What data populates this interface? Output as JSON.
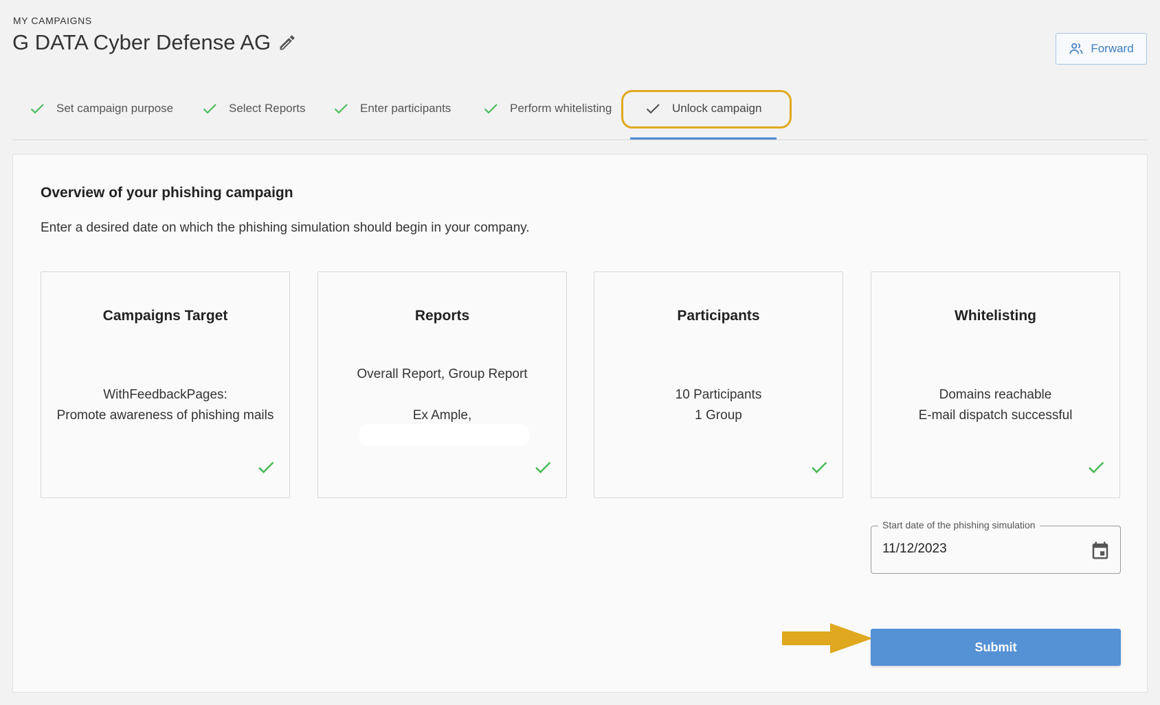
{
  "header": {
    "breadcrumb": "MY CAMPAIGNS",
    "title": "G DATA Cyber Defense AG",
    "forward_label": "Forward"
  },
  "steps": [
    {
      "label": "Set campaign purpose",
      "state": "done"
    },
    {
      "label": "Select Reports",
      "state": "done"
    },
    {
      "label": "Enter participants",
      "state": "done"
    },
    {
      "label": "Perform whitelisting",
      "state": "done"
    },
    {
      "label": "Unlock campaign",
      "state": "active"
    }
  ],
  "overview": {
    "title": "Overview of your phishing campaign",
    "description": "Enter a desired date on which the phishing simulation should begin in your company."
  },
  "cards": [
    {
      "title": "Campaigns Target",
      "lines": [
        "WithFeedbackPages:",
        "Promote awareness of phishing mails"
      ]
    },
    {
      "title": "Reports",
      "lines": [
        "Overall Report, Group Report",
        "",
        "Ex Ample,"
      ]
    },
    {
      "title": "Participants",
      "lines": [
        "10 Participants",
        "1 Group"
      ]
    },
    {
      "title": "Whitelisting",
      "lines": [
        "Domains reachable",
        "E-mail dispatch successful"
      ]
    }
  ],
  "date_field": {
    "label": "Start date of the phishing simulation",
    "value": "11/12/2023"
  },
  "submit_label": "Submit",
  "colors": {
    "accent": "#5591d5",
    "highlight": "#dfa81f",
    "check_done": "#4cbb5c",
    "check_active": "#555555"
  },
  "icons": {
    "edit": "pencil-icon",
    "forward": "people-icon",
    "step_check": "check-icon",
    "calendar": "calendar-icon",
    "annotation": "arrow-right-icon"
  }
}
